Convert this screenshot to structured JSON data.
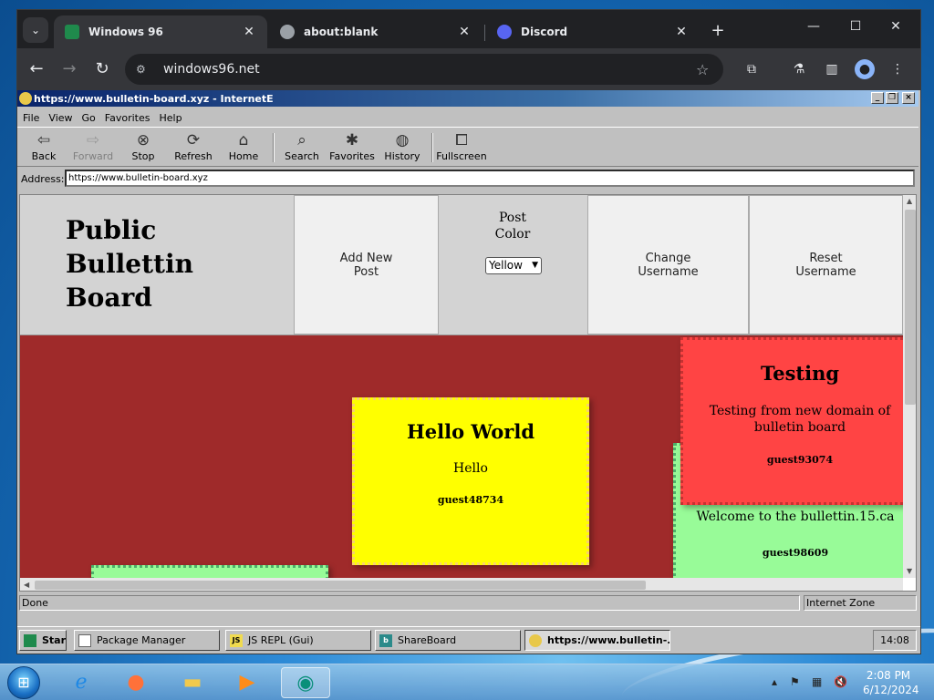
{
  "chrome": {
    "tabs": [
      {
        "title": "Windows 96",
        "active": true
      },
      {
        "title": "about:blank",
        "active": false
      },
      {
        "title": "Discord",
        "active": false
      }
    ],
    "url": "windows96.net"
  },
  "ie": {
    "title": "https://www.bulletin-board.xyz - InternetE",
    "menu": [
      "File",
      "View",
      "Go",
      "Favorites",
      "Help"
    ],
    "tools": {
      "back": "Back",
      "forward": "Forward",
      "stop": "Stop",
      "refresh": "Refresh",
      "home": "Home",
      "search": "Search",
      "favorites": "Favorites",
      "history": "History",
      "fullscreen": "Fullscreen"
    },
    "address_label": "Address:",
    "address_value": "https://www.bulletin-board.xyz",
    "status_left": "Done",
    "status_right": "Internet Zone"
  },
  "board": {
    "title_line1": "Public",
    "title_line2": "Bullettin",
    "title_line3": "Board",
    "add_post_line1": "Add New",
    "add_post_line2": "Post",
    "post_color_line1": "Post",
    "post_color_line2": "Color",
    "post_color_value": "Yellow",
    "change_line1": "Change",
    "change_line2": "Username",
    "reset_line1": "Reset",
    "reset_line2": "Username",
    "notes": [
      {
        "title": "Hello World",
        "body": "Hello",
        "user": "guest48734",
        "color": "#ffff00"
      },
      {
        "title": "",
        "body": "Welcome to the bullettin.15.ca",
        "user": "guest98609",
        "color": "#98fb98"
      },
      {
        "title": "Testing",
        "body": "Testing from new domain of bulletin board",
        "user": "guest93074",
        "color": "#ff4444"
      }
    ],
    "background_color": "#9f2a2a"
  },
  "w96_taskbar": {
    "start": "Start",
    "items": [
      "Package Manager",
      "JS REPL (Gui)",
      "ShareBoard",
      "https://www.bulletin-..."
    ],
    "clock": "14:08"
  },
  "win7": {
    "time": "2:08 PM",
    "date": "6/12/2024"
  }
}
